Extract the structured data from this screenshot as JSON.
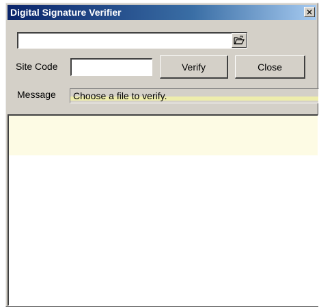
{
  "window": {
    "title": "Digital Signature Verifier",
    "close_glyph": "✕"
  },
  "file": {
    "value": "",
    "browse_icon": "folder-open-icon"
  },
  "site_code": {
    "label": "Site Code",
    "value": ""
  },
  "buttons": {
    "verify": "Verify",
    "close": "Close"
  },
  "message": {
    "label": "Message",
    "text": "Choose a file to verify."
  },
  "output": {
    "text": ""
  },
  "colors": {
    "title_start": "#0a246a",
    "title_end": "#a6caf0",
    "face": "#d4d0c8",
    "highlight": "#f1f0a8"
  }
}
